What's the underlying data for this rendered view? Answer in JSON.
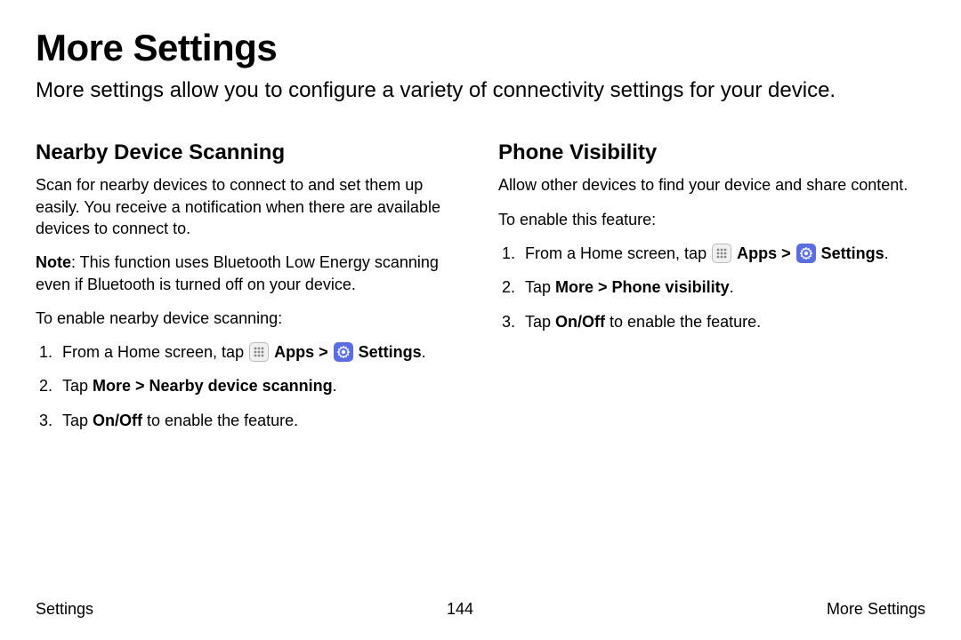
{
  "title": "More Settings",
  "intro": "More settings allow you to configure a variety of connectivity settings for your device.",
  "left": {
    "heading": "Nearby Device Scanning",
    "p1": "Scan for nearby devices to connect to and set them up easily. You receive a notification when there are available devices to connect to.",
    "note_label": "Note",
    "note_text": ": This function uses Bluetooth Low Energy scanning even if Bluetooth is turned off on your device.",
    "lead": "To enable nearby device scanning:",
    "step1_prefix": "From a Home screen, tap ",
    "apps_label": "Apps",
    "sep": " > ",
    "settings_label": "Settings",
    "period": ".",
    "step2_prefix": "Tap ",
    "step2_bold": "More > Nearby device scanning",
    "step3_prefix": "Tap ",
    "step3_bold": "On/Off",
    "step3_suffix": " to enable the feature."
  },
  "right": {
    "heading": "Phone Visibility",
    "p1": "Allow other devices to find your device and share content.",
    "lead": "To enable this feature:",
    "step1_prefix": "From a Home screen, tap ",
    "apps_label": "Apps",
    "sep": " > ",
    "settings_label": "Settings",
    "period": ".",
    "step2_prefix": "Tap ",
    "step2_bold": "More > Phone visibility",
    "step3_prefix": "Tap ",
    "step3_bold": "On/Off",
    "step3_suffix": " to enable the feature."
  },
  "footer": {
    "left": "Settings",
    "center": "144",
    "right": "More Settings"
  }
}
